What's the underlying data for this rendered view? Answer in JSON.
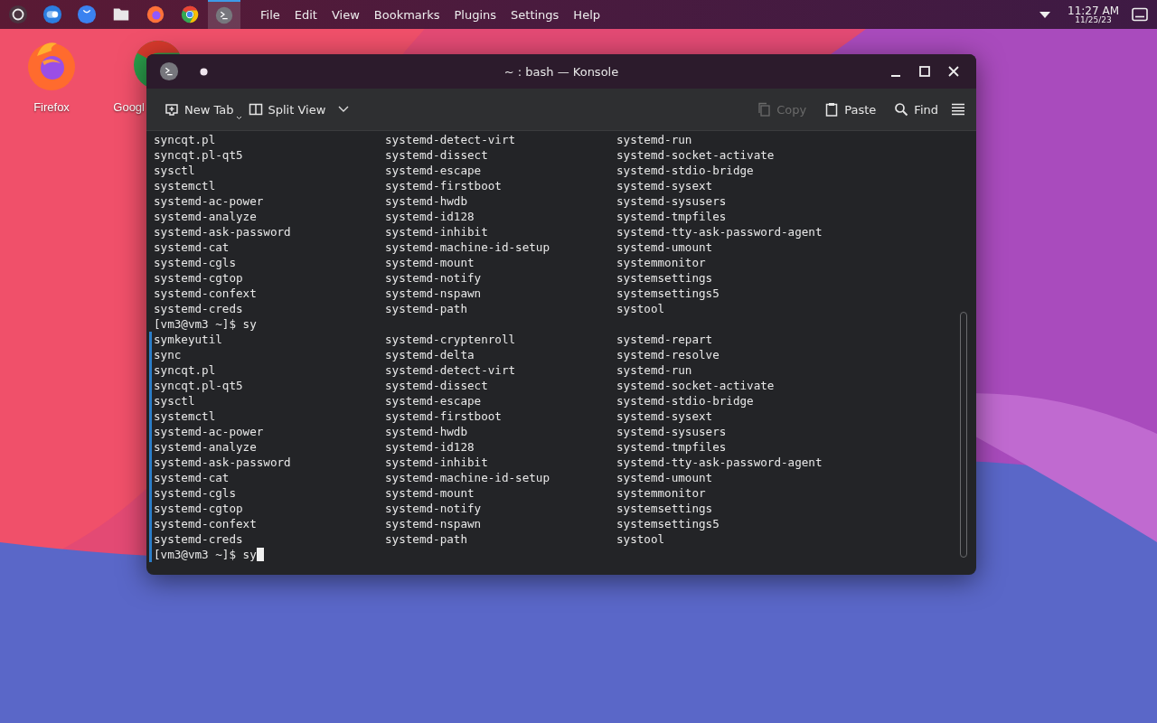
{
  "panel": {
    "launchers": [
      {
        "kind": "app-menu",
        "selected": false
      },
      {
        "kind": "toggle",
        "selected": false
      },
      {
        "kind": "store",
        "selected": false
      },
      {
        "kind": "folder",
        "selected": false
      },
      {
        "kind": "firefox",
        "selected": false
      },
      {
        "kind": "chrome",
        "selected": false
      },
      {
        "kind": "terminal",
        "selected": true
      }
    ],
    "menu": [
      "File",
      "Edit",
      "View",
      "Bookmarks",
      "Plugins",
      "Settings",
      "Help"
    ],
    "time": "11:27 AM",
    "date": "11/25/23"
  },
  "desktop_icons": [
    {
      "kind": "firefox",
      "label": "Firefox"
    },
    {
      "kind": "chrome",
      "label": "Googl"
    }
  ],
  "window": {
    "title": "~ : bash — Konsole",
    "toolbar_left": [
      {
        "kind": "new-tab",
        "label": "New Tab"
      },
      {
        "kind": "split-view",
        "label": "Split View"
      }
    ],
    "toolbar_right": [
      {
        "kind": "copy",
        "label": "Copy",
        "disabled": true
      },
      {
        "kind": "paste",
        "label": "Paste",
        "disabled": false
      },
      {
        "kind": "find",
        "label": "Find",
        "disabled": false
      }
    ],
    "lines": [
      {
        "kind": "listing",
        "marked": false,
        "cells": [
          "syncqt.pl",
          "systemd-detect-virt",
          "systemd-run"
        ]
      },
      {
        "kind": "listing",
        "marked": false,
        "cells": [
          "syncqt.pl-qt5",
          "systemd-dissect",
          "systemd-socket-activate"
        ]
      },
      {
        "kind": "listing",
        "marked": false,
        "cells": [
          "sysctl",
          "systemd-escape",
          "systemd-stdio-bridge"
        ]
      },
      {
        "kind": "listing",
        "marked": false,
        "cells": [
          "systemctl",
          "systemd-firstboot",
          "systemd-sysext"
        ]
      },
      {
        "kind": "listing",
        "marked": false,
        "cells": [
          "systemd-ac-power",
          "systemd-hwdb",
          "systemd-sysusers"
        ]
      },
      {
        "kind": "listing",
        "marked": false,
        "cells": [
          "systemd-analyze",
          "systemd-id128",
          "systemd-tmpfiles"
        ]
      },
      {
        "kind": "listing",
        "marked": false,
        "cells": [
          "systemd-ask-password",
          "systemd-inhibit",
          "systemd-tty-ask-password-agent"
        ]
      },
      {
        "kind": "listing",
        "marked": false,
        "cells": [
          "systemd-cat",
          "systemd-machine-id-setup",
          "systemd-umount"
        ]
      },
      {
        "kind": "listing",
        "marked": false,
        "cells": [
          "systemd-cgls",
          "systemd-mount",
          "systemmonitor"
        ]
      },
      {
        "kind": "listing",
        "marked": false,
        "cells": [
          "systemd-cgtop",
          "systemd-notify",
          "systemsettings"
        ]
      },
      {
        "kind": "listing",
        "marked": false,
        "cells": [
          "systemd-confext",
          "systemd-nspawn",
          "systemsettings5"
        ]
      },
      {
        "kind": "listing",
        "marked": false,
        "cells": [
          "systemd-creds",
          "systemd-path",
          "systool"
        ]
      },
      {
        "kind": "prompt",
        "marked": false,
        "cursor": false,
        "text": "[vm3@vm3 ~]$ sy"
      },
      {
        "kind": "listing",
        "marked": true,
        "cells": [
          "symkeyutil",
          "systemd-cryptenroll",
          "systemd-repart"
        ]
      },
      {
        "kind": "listing",
        "marked": true,
        "cells": [
          "sync",
          "systemd-delta",
          "systemd-resolve"
        ]
      },
      {
        "kind": "listing",
        "marked": true,
        "cells": [
          "syncqt.pl",
          "systemd-detect-virt",
          "systemd-run"
        ]
      },
      {
        "kind": "listing",
        "marked": true,
        "cells": [
          "syncqt.pl-qt5",
          "systemd-dissect",
          "systemd-socket-activate"
        ]
      },
      {
        "kind": "listing",
        "marked": true,
        "cells": [
          "sysctl",
          "systemd-escape",
          "systemd-stdio-bridge"
        ]
      },
      {
        "kind": "listing",
        "marked": true,
        "cells": [
          "systemctl",
          "systemd-firstboot",
          "systemd-sysext"
        ]
      },
      {
        "kind": "listing",
        "marked": true,
        "cells": [
          "systemd-ac-power",
          "systemd-hwdb",
          "systemd-sysusers"
        ]
      },
      {
        "kind": "listing",
        "marked": true,
        "cells": [
          "systemd-analyze",
          "systemd-id128",
          "systemd-tmpfiles"
        ]
      },
      {
        "kind": "listing",
        "marked": true,
        "cells": [
          "systemd-ask-password",
          "systemd-inhibit",
          "systemd-tty-ask-password-agent"
        ]
      },
      {
        "kind": "listing",
        "marked": true,
        "cells": [
          "systemd-cat",
          "systemd-machine-id-setup",
          "systemd-umount"
        ]
      },
      {
        "kind": "listing",
        "marked": true,
        "cells": [
          "systemd-cgls",
          "systemd-mount",
          "systemmonitor"
        ]
      },
      {
        "kind": "listing",
        "marked": true,
        "cells": [
          "systemd-cgtop",
          "systemd-notify",
          "systemsettings"
        ]
      },
      {
        "kind": "listing",
        "marked": true,
        "cells": [
          "systemd-confext",
          "systemd-nspawn",
          "systemsettings5"
        ]
      },
      {
        "kind": "listing",
        "marked": true,
        "cells": [
          "systemd-creds",
          "systemd-path",
          "systool"
        ]
      },
      {
        "kind": "prompt",
        "marked": true,
        "cursor": true,
        "text": "[vm3@vm3 ~]$ sy"
      }
    ]
  }
}
